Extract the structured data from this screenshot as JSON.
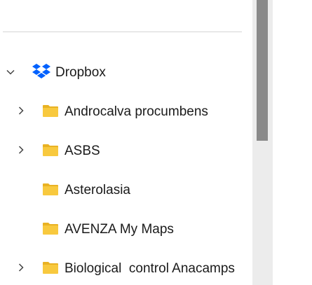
{
  "tree": {
    "root": {
      "label": "Dropbox",
      "icon": "dropbox-icon",
      "expanded": true
    },
    "items": [
      {
        "label": "Androcalva procumbens",
        "has_children": true,
        "icon": "folder-icon"
      },
      {
        "label": "ASBS",
        "has_children": true,
        "icon": "folder-icon"
      },
      {
        "label": "Asterolasia",
        "has_children": false,
        "icon": "folder-icon"
      },
      {
        "label": "AVENZA My Maps",
        "has_children": false,
        "icon": "folder-icon"
      },
      {
        "label": "Biological  control Anacamps",
        "has_children": true,
        "icon": "folder-icon"
      }
    ]
  },
  "colors": {
    "folder": "#f8c93e",
    "folder_back": "#e9b224",
    "dropbox": "#0061fe",
    "scrollbar_thumb": "#8a8a8a",
    "scrollbar_track": "#ececec"
  }
}
